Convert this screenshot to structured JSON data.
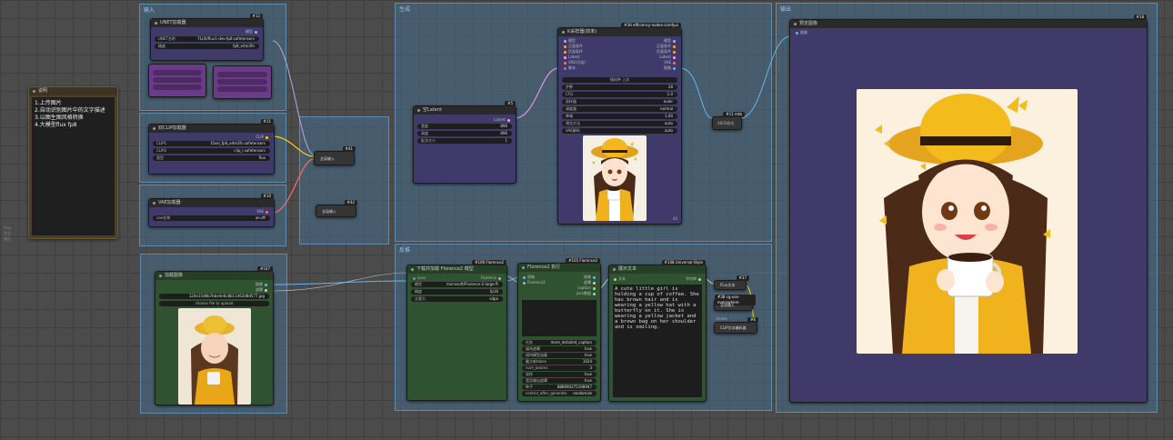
{
  "note": {
    "title": "说明",
    "lines": [
      "1.上传图片",
      "2.自动识别图片中的文字描述",
      "3.以图生图风格转换",
      "4.大模型flux fp8"
    ]
  },
  "left_labels": [
    "Flux",
    "文生",
    "图生"
  ],
  "groups": {
    "g1": "输入",
    "g2": "",
    "g3": "",
    "g4": "",
    "g5": "",
    "g6": "生成",
    "g7": "反推",
    "g8": "输出"
  },
  "unet_node": {
    "id": "#12",
    "title": "UNET加载器",
    "rows": [
      [
        "UNET名称",
        "FLUX/flux1-dev-fp8.safetensors"
      ],
      [
        "精度",
        "fp8_e4m3fn"
      ]
    ],
    "out": "模型"
  },
  "clip_node": {
    "id": "#11",
    "title": "双CLIP加载器",
    "out": "CLIP",
    "rows": [
      [
        "CLIP1",
        "t5xxl_fp8_e4m3fn.safetensors"
      ],
      [
        "CLIP2",
        "clip_l.safetensors"
      ],
      [
        "类型",
        "flux"
      ]
    ]
  },
  "vae_node": {
    "id": "#10",
    "title": "VAE加载器",
    "out": "VAE",
    "rows": [
      [
        "vae名称",
        "ae.sft"
      ]
    ]
  },
  "anything_nodes": [
    {
      "id": "#41",
      "title": "cg-use-everywhere",
      "label": "全局输入"
    },
    {
      "id": "#42",
      "title": "cg-use-everywhere",
      "label": "全局输入"
    }
  ],
  "latent_node": {
    "id": "#5",
    "title": "空Latent",
    "out": "Latent",
    "rows": [
      [
        "宽度",
        "896"
      ],
      [
        "高度",
        "896"
      ],
      [
        "批次大小",
        "1"
      ]
    ]
  },
  "ksampler_node": {
    "id": "#36 efficiency-nodes-comfyui",
    "title": "K采样器(效率)",
    "inputs": [
      "模型",
      "正面条件",
      "负面条件",
      "Latent",
      "VAE(可选)",
      "脚本"
    ],
    "outputs": [
      "模型",
      "正面条件",
      "负面条件",
      "Latent",
      "VAE",
      "图像"
    ],
    "toggle": "随机种 上次",
    "rows": [
      [
        "步数",
        "28"
      ],
      [
        "CFG",
        "1.0"
      ],
      [
        "采样器",
        "euler"
      ],
      [
        "调度器",
        "normal"
      ],
      [
        "降噪",
        "1.00"
      ],
      [
        "预览方法",
        "auto"
      ],
      [
        "VAE解码",
        "auto"
      ]
    ],
    "footer": "40"
  },
  "style_node": {
    "id": "#11 mtb",
    "title": "Style",
    "label": "ASCII样式"
  },
  "preview_node": {
    "id": "#18",
    "title": "预览图像",
    "input": "图像"
  },
  "load_image_node": {
    "id": "#107",
    "title": "加载图像",
    "outs": [
      "图像",
      "遮罩"
    ],
    "file": "124e15d8b7bbe4e6c8b11463d8d577.jpg",
    "upload": "choose file to upload"
  },
  "florence_loader": {
    "id": "#106 Florence2",
    "title": "下载并加载 Florence2 模型",
    "out": "Florence",
    "rows": [
      [
        "模型",
        "microsoft/Florence-2-large-ft"
      ],
      [
        "精度",
        "fp16"
      ],
      [
        "注意力",
        "sdpa"
      ]
    ]
  },
  "florence_run": {
    "id": "#105 Florence2",
    "title": "Florence2 执行",
    "inputs": [
      "图像",
      "Florence2"
    ],
    "outputs": [
      "图像",
      "遮罩",
      "caption",
      "json数据"
    ],
    "rows": [
      [
        "任务",
        "more_detailed_caption"
      ],
      [
        "填充遮罩",
        "true"
      ],
      [
        "保持模型加载",
        "true"
      ],
      [
        "最大新token",
        "1024"
      ],
      [
        "num_beams",
        "3"
      ],
      [
        "采样",
        "true"
      ],
      [
        "是否输出遮罩",
        "true"
      ],
      [
        "种子",
        "888690275198947"
      ],
      [
        "control_after_generate",
        "randomize"
      ]
    ]
  },
  "show_text_node": {
    "id": "#108 Universal-Style",
    "title": "展示文本",
    "in": "文本",
    "out": "字符串",
    "text": "A cute little girl is holding a cup of coffee. She has brown hair and is wearing a yellow hat with a butterfly on it. She is wearing a yellow jacket and a brown bag on her shoulder and is smiling."
  },
  "clip_text_nodes": [
    {
      "id": "#37",
      "title": "Flux文本"
    },
    {
      "id": "#38 cg-use-everywhere",
      "title": "全局输入"
    },
    {
      "id": "#6",
      "title": "CLIP文本编码器",
      "sub": "Unode"
    }
  ],
  "colors": {
    "purple_node": "#3f3a6a",
    "green_node": "#2f5230",
    "group": "#466e8c",
    "bg": "#4b4b4b"
  }
}
